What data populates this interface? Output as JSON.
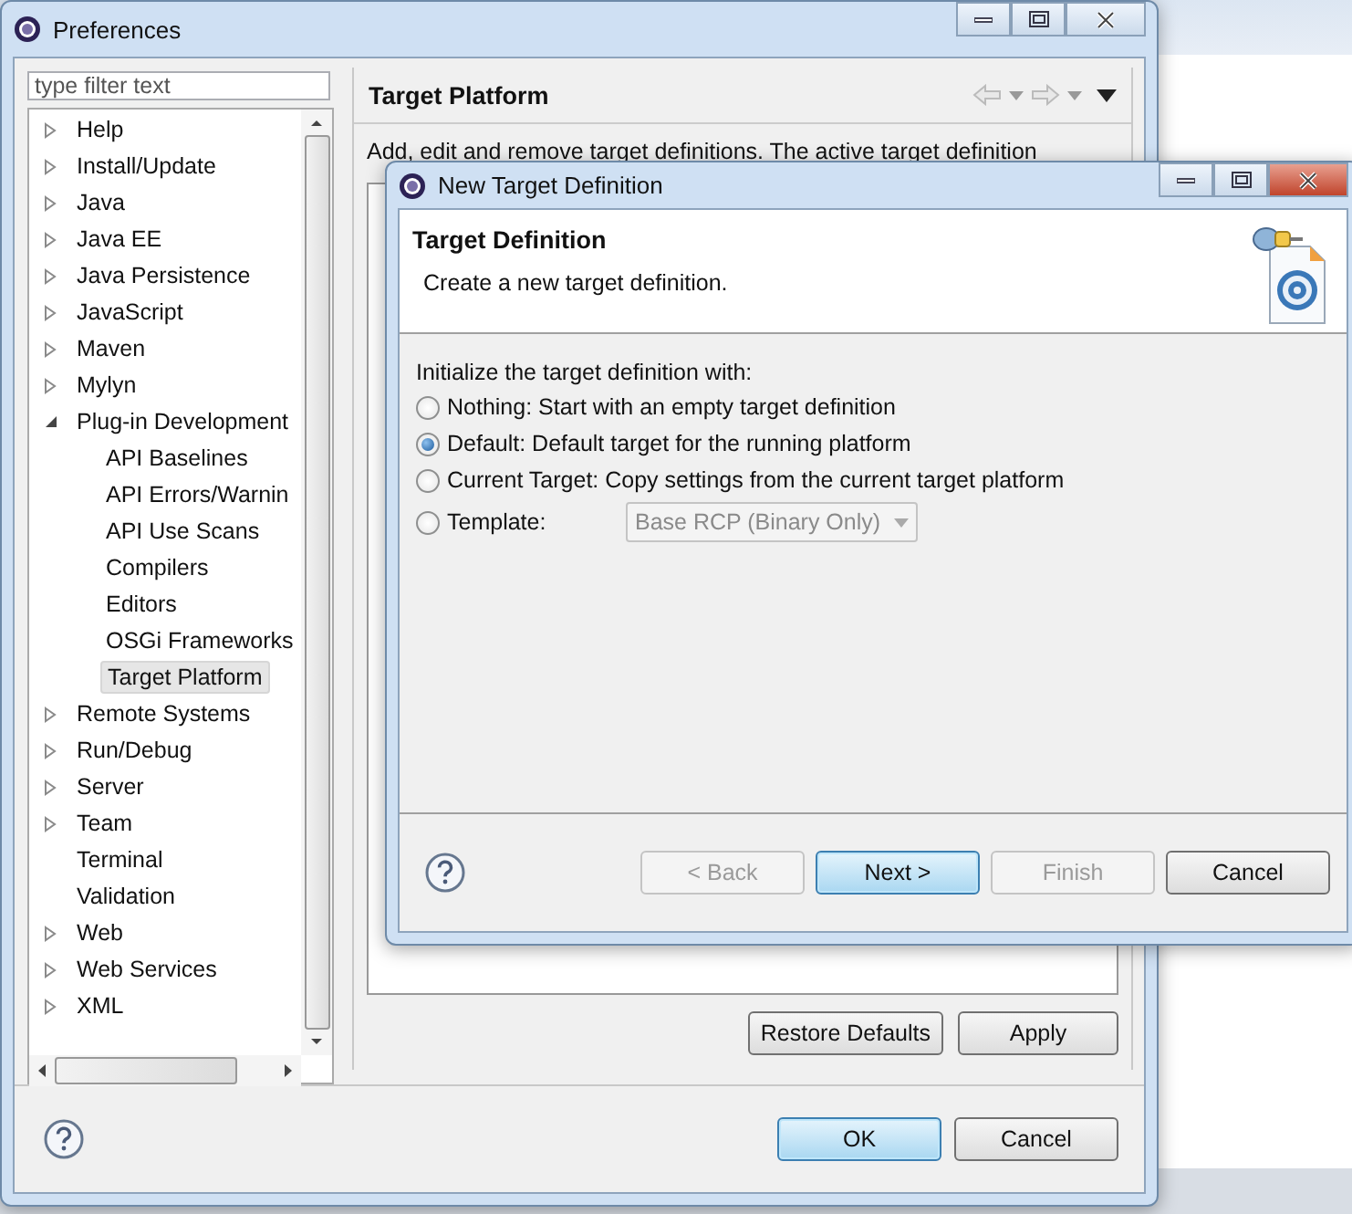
{
  "preferences_window": {
    "title": "Preferences",
    "filter": {
      "placeholder": "type filter text"
    },
    "tree": [
      {
        "label": "Help",
        "kind": "branch",
        "expanded": false,
        "selected": false
      },
      {
        "label": "Install/Update",
        "kind": "branch",
        "expanded": false,
        "selected": false
      },
      {
        "label": "Java",
        "kind": "branch",
        "expanded": false,
        "selected": false
      },
      {
        "label": "Java EE",
        "kind": "branch",
        "expanded": false,
        "selected": false
      },
      {
        "label": "Java Persistence",
        "kind": "branch",
        "expanded": false,
        "selected": false
      },
      {
        "label": "JavaScript",
        "kind": "branch",
        "expanded": false,
        "selected": false
      },
      {
        "label": "Maven",
        "kind": "branch",
        "expanded": false,
        "selected": false
      },
      {
        "label": "Mylyn",
        "kind": "branch",
        "expanded": false,
        "selected": false
      },
      {
        "label": "Plug-in Development",
        "kind": "branch",
        "expanded": true,
        "selected": false,
        "children": [
          {
            "label": "API Baselines",
            "selected": false
          },
          {
            "label": "API Errors/Warnin",
            "selected": false
          },
          {
            "label": "API Use Scans",
            "selected": false
          },
          {
            "label": "Compilers",
            "selected": false
          },
          {
            "label": "Editors",
            "selected": false
          },
          {
            "label": "OSGi Frameworks",
            "selected": false
          },
          {
            "label": "Target Platform",
            "selected": true
          }
        ]
      },
      {
        "label": "Remote Systems",
        "kind": "branch",
        "expanded": false,
        "selected": false
      },
      {
        "label": "Run/Debug",
        "kind": "branch",
        "expanded": false,
        "selected": false
      },
      {
        "label": "Server",
        "kind": "branch",
        "expanded": false,
        "selected": false
      },
      {
        "label": "Team",
        "kind": "branch",
        "expanded": false,
        "selected": false
      },
      {
        "label": "Terminal",
        "kind": "leaf",
        "selected": false
      },
      {
        "label": "Validation",
        "kind": "leaf",
        "selected": false
      },
      {
        "label": "Web",
        "kind": "branch",
        "expanded": false,
        "selected": false
      },
      {
        "label": "Web Services",
        "kind": "branch",
        "expanded": false,
        "selected": false
      },
      {
        "label": "XML",
        "kind": "branch",
        "expanded": false,
        "selected": false
      }
    ],
    "page": {
      "title": "Target Platform",
      "description": "Add, edit and remove target definitions.  The active target definition",
      "buttons": [
        {
          "label": "Restore Defaults"
        },
        {
          "label": "Apply"
        }
      ]
    },
    "buttons": [
      {
        "label": "OK",
        "default": true
      },
      {
        "label": "Cancel",
        "default": false
      }
    ]
  },
  "dialog": {
    "title": "New Target Definition",
    "header": {
      "title": "Target Definition",
      "subtitle": "Create a new target definition."
    },
    "prompt": "Initialize the target definition with:",
    "options": [
      {
        "label": "Nothing: Start with an empty target definition",
        "selected": false
      },
      {
        "label": "Default: Default target for the running platform",
        "selected": true
      },
      {
        "label": "Current Target: Copy settings from the current target platform",
        "selected": false
      },
      {
        "label": "Template:",
        "selected": false
      }
    ],
    "template": {
      "value": "Base RCP (Binary Only)",
      "disabled": true
    },
    "buttons": [
      {
        "label": "< Back",
        "disabled": true,
        "default": false
      },
      {
        "label": "Next >",
        "disabled": false,
        "default": true
      },
      {
        "label": "Finish",
        "disabled": true,
        "default": false
      },
      {
        "label": "Cancel",
        "disabled": false,
        "default": false
      }
    ]
  }
}
